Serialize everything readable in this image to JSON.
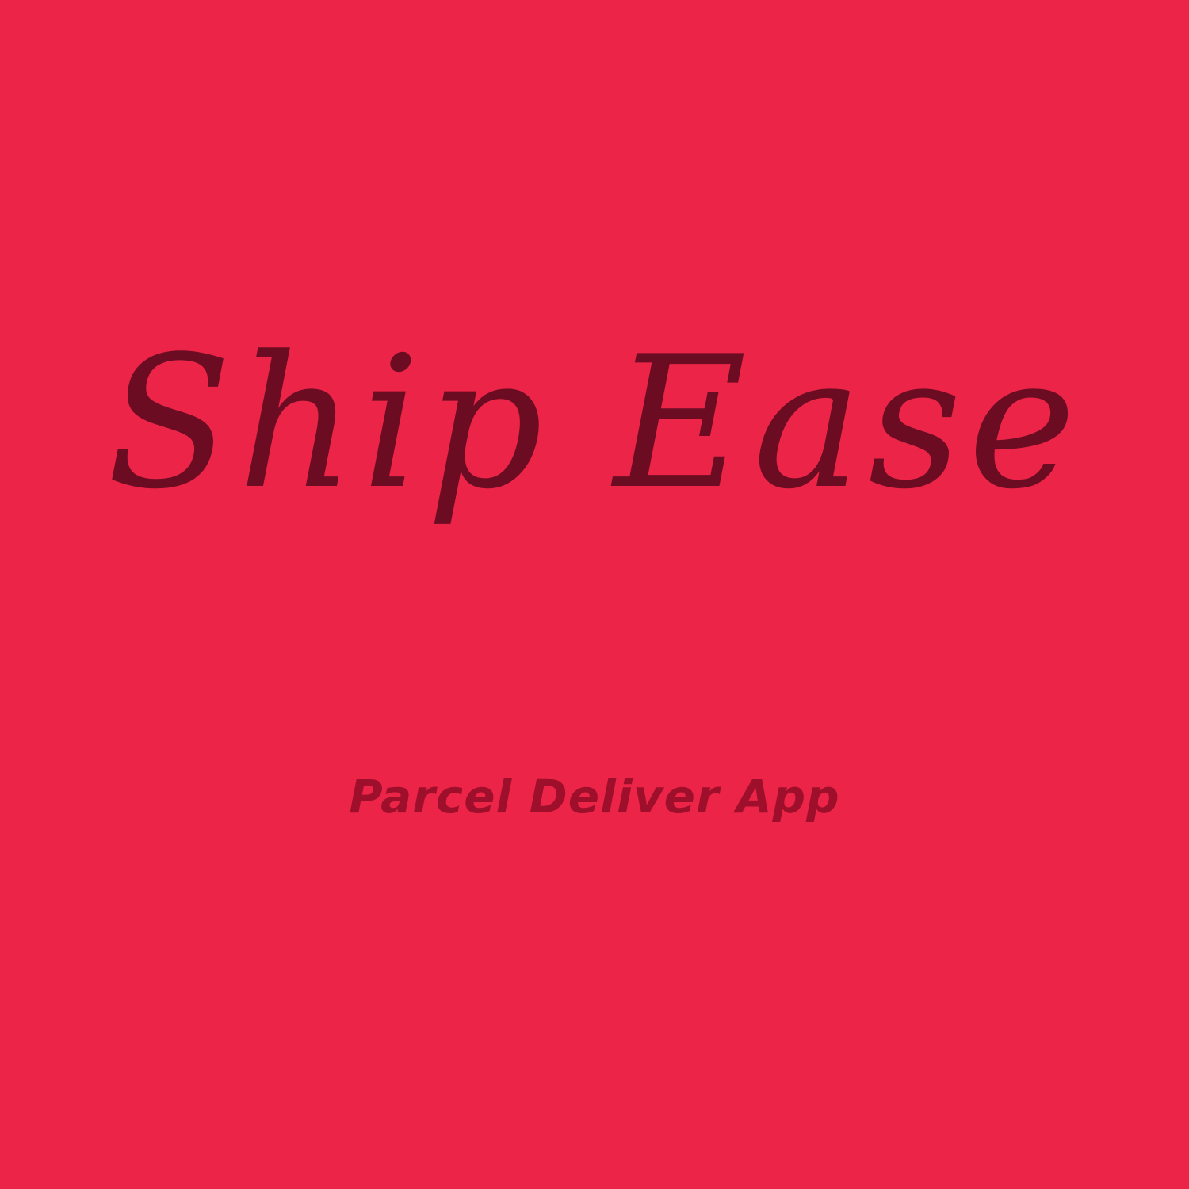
{
  "splash": {
    "app_name": "Ship Ease",
    "tagline": "Parcel Deliver App"
  },
  "colors": {
    "background": "#ec2548",
    "title": "#6b0c22",
    "tagline": "#9e0f2c"
  }
}
